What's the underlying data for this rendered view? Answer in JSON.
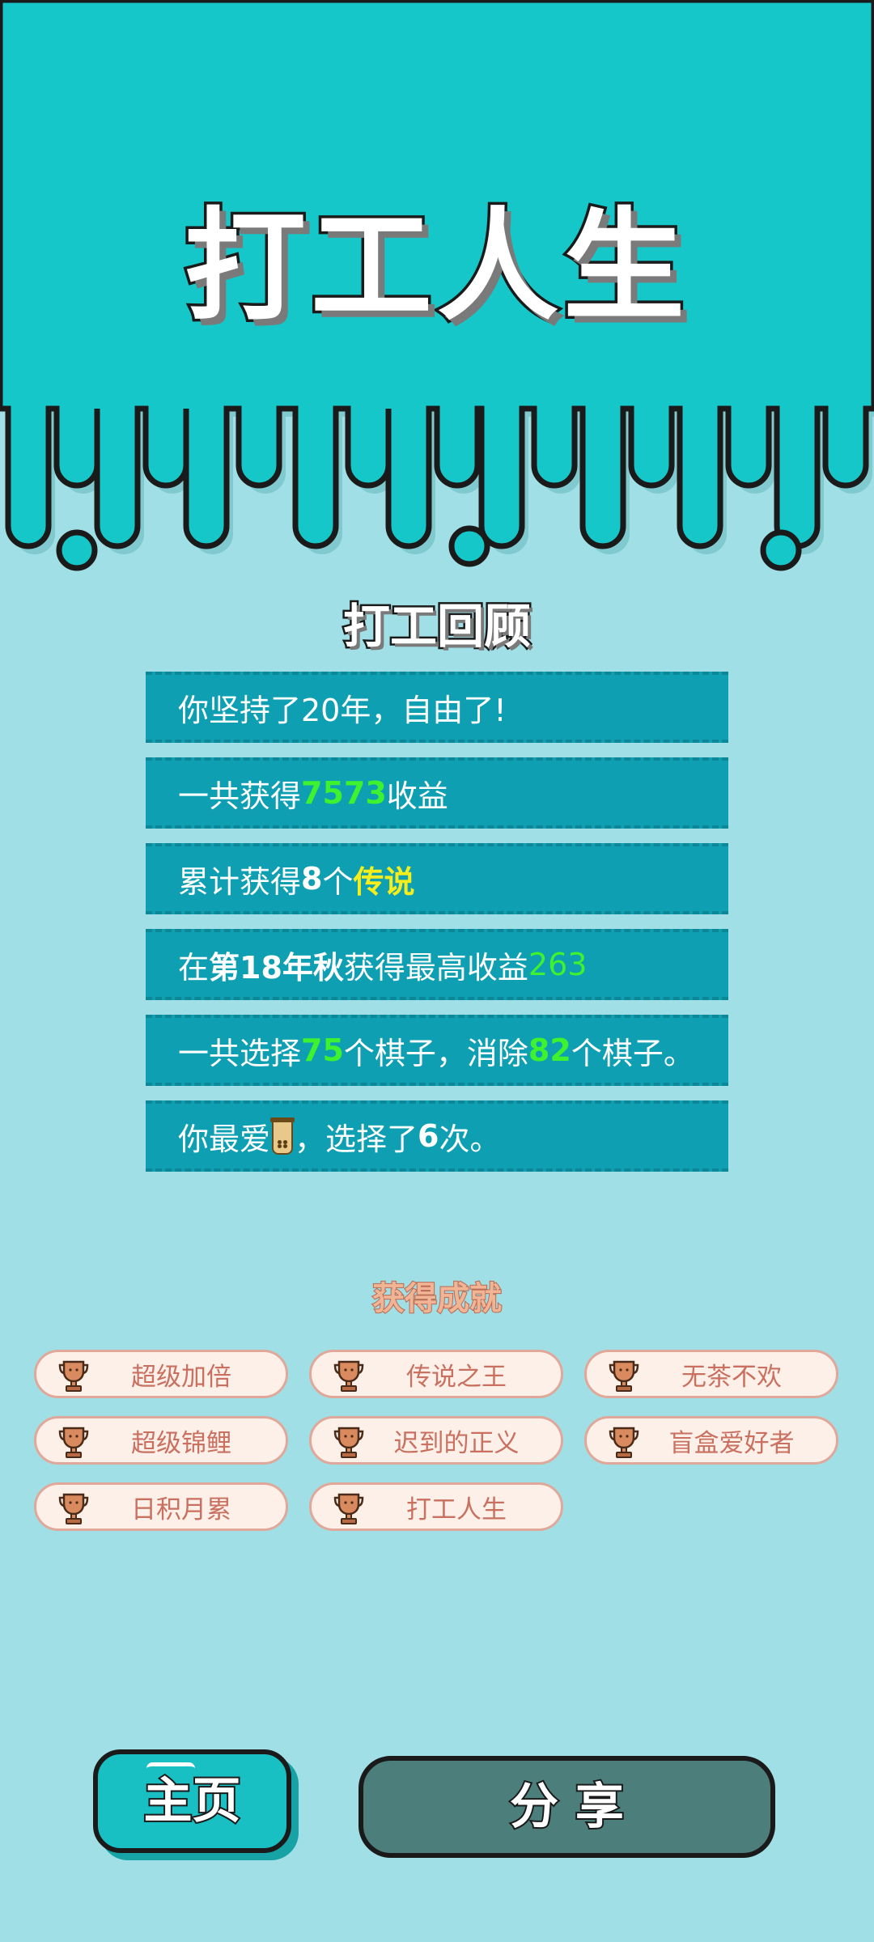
{
  "title": "打工人生",
  "review": {
    "heading": "打工回顾",
    "stats": [
      {
        "parts": [
          "你坚持了20年，自由了!"
        ]
      },
      {
        "pre": "一共获得",
        "value": "7573",
        "post": "收益"
      },
      {
        "pre": "累计获得",
        "count": "8",
        "mid": "个",
        "highlight": "传说"
      },
      {
        "pre": "在 ",
        "season": "第18年秋",
        "mid": " 获得最高收益",
        "value": "263"
      },
      {
        "pre": "一共选择",
        "v1": "75",
        "mid": "个棋子，消除",
        "v2": "82",
        "post": "个棋子。"
      },
      {
        "pre": "你最爱",
        "item_icon": "milk-tea-cup-icon",
        "mid": "，选择了",
        "count": "6",
        "post": "次。"
      }
    ]
  },
  "achievements": {
    "heading": "获得成就",
    "items": [
      "超级加倍",
      "传说之王",
      "无茶不欢",
      "超级锦鲤",
      "迟到的正义",
      "盲盒爱好者",
      "日积月累",
      "打工人生"
    ]
  },
  "buttons": {
    "home": "主页",
    "share": "分 享"
  },
  "colors": {
    "top": "#16c7c9",
    "bottom": "#a0dfe5",
    "row": "#0f9fb2",
    "green": "#3df22e",
    "yellow": "#f5ee1c",
    "badge_text": "#c97060"
  }
}
